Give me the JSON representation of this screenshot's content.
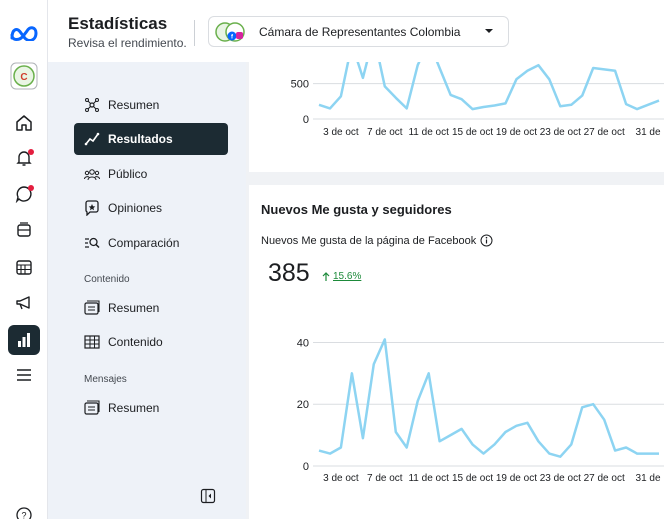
{
  "header": {
    "title": "Estadísticas",
    "subtitle": "Revisa el rendimiento.",
    "account_name": "Cámara de Representantes Colombia"
  },
  "rail": {
    "icons": [
      "meta-logo-icon",
      "page-avatar",
      "home-icon",
      "notifications-icon",
      "messages-icon",
      "content-icon",
      "planner-icon",
      "ads-icon",
      "insights-icon",
      "menu-icon",
      "help-icon"
    ]
  },
  "nav": {
    "items": [
      {
        "label": "Resumen",
        "icon": "overview-icon"
      },
      {
        "label": "Resultados",
        "icon": "results-icon",
        "selected": true
      },
      {
        "label": "Público",
        "icon": "audience-icon"
      },
      {
        "label": "Opiniones",
        "icon": "feedback-icon"
      },
      {
        "label": "Comparación",
        "icon": "benchmark-icon"
      }
    ],
    "section_content": "Contenido",
    "content_items": [
      {
        "label": "Resumen",
        "icon": "content-overview-icon"
      },
      {
        "label": "Contenido",
        "icon": "table-icon"
      }
    ],
    "section_messages": "Mensajes",
    "message_items": [
      {
        "label": "Resumen",
        "icon": "messages-overview-icon"
      }
    ]
  },
  "top_card": {
    "chart_data": {
      "type": "line",
      "x_tick_labels": [
        "3 de oct",
        "7 de oct",
        "11 de oct",
        "15 de oct",
        "19 de oct",
        "23 de oct",
        "27 de oct",
        "31 de"
      ],
      "y_tick_labels": [
        "0",
        "500"
      ],
      "ylim": [
        0,
        1200
      ],
      "x": [
        1,
        2,
        3,
        4,
        5,
        6,
        7,
        8,
        9,
        10,
        11,
        12,
        13,
        14,
        15,
        16,
        17,
        18,
        19,
        20,
        21,
        22,
        23,
        24,
        25,
        26,
        27,
        28,
        29,
        30,
        31,
        32
      ],
      "values": [
        200,
        150,
        320,
        1060,
        580,
        1180,
        460,
        300,
        150,
        760,
        1100,
        720,
        340,
        280,
        140,
        170,
        190,
        220,
        560,
        680,
        760,
        560,
        180,
        200,
        330,
        720,
        700,
        680,
        210,
        140,
        200,
        260
      ],
      "line_color": "#8dd4f2"
    }
  },
  "likes_card": {
    "section_title": "Nuevos Me gusta y seguidores",
    "metric_label": "Nuevos Me gusta de la página de Facebook",
    "value": "385",
    "change": "15.6%",
    "chart_data": {
      "type": "line",
      "x_tick_labels": [
        "3 de oct",
        "7 de oct",
        "11 de oct",
        "15 de oct",
        "19 de oct",
        "23 de oct",
        "27 de oct",
        "31 de"
      ],
      "y_tick_labels": [
        "0",
        "20",
        "40"
      ],
      "ylim": [
        0,
        45
      ],
      "x": [
        1,
        2,
        3,
        4,
        5,
        6,
        7,
        8,
        9,
        10,
        11,
        12,
        13,
        14,
        15,
        16,
        17,
        18,
        19,
        20,
        21,
        22,
        23,
        24,
        25,
        26,
        27,
        28,
        29,
        30,
        31,
        32
      ],
      "values": [
        5,
        4,
        6,
        30,
        9,
        33,
        41,
        11,
        6,
        21,
        30,
        8,
        10,
        12,
        7,
        4,
        7,
        11,
        13,
        14,
        8,
        4,
        3,
        7,
        19,
        20,
        15,
        5,
        6,
        4,
        4,
        4
      ],
      "line_color": "#8dd4f2"
    }
  }
}
